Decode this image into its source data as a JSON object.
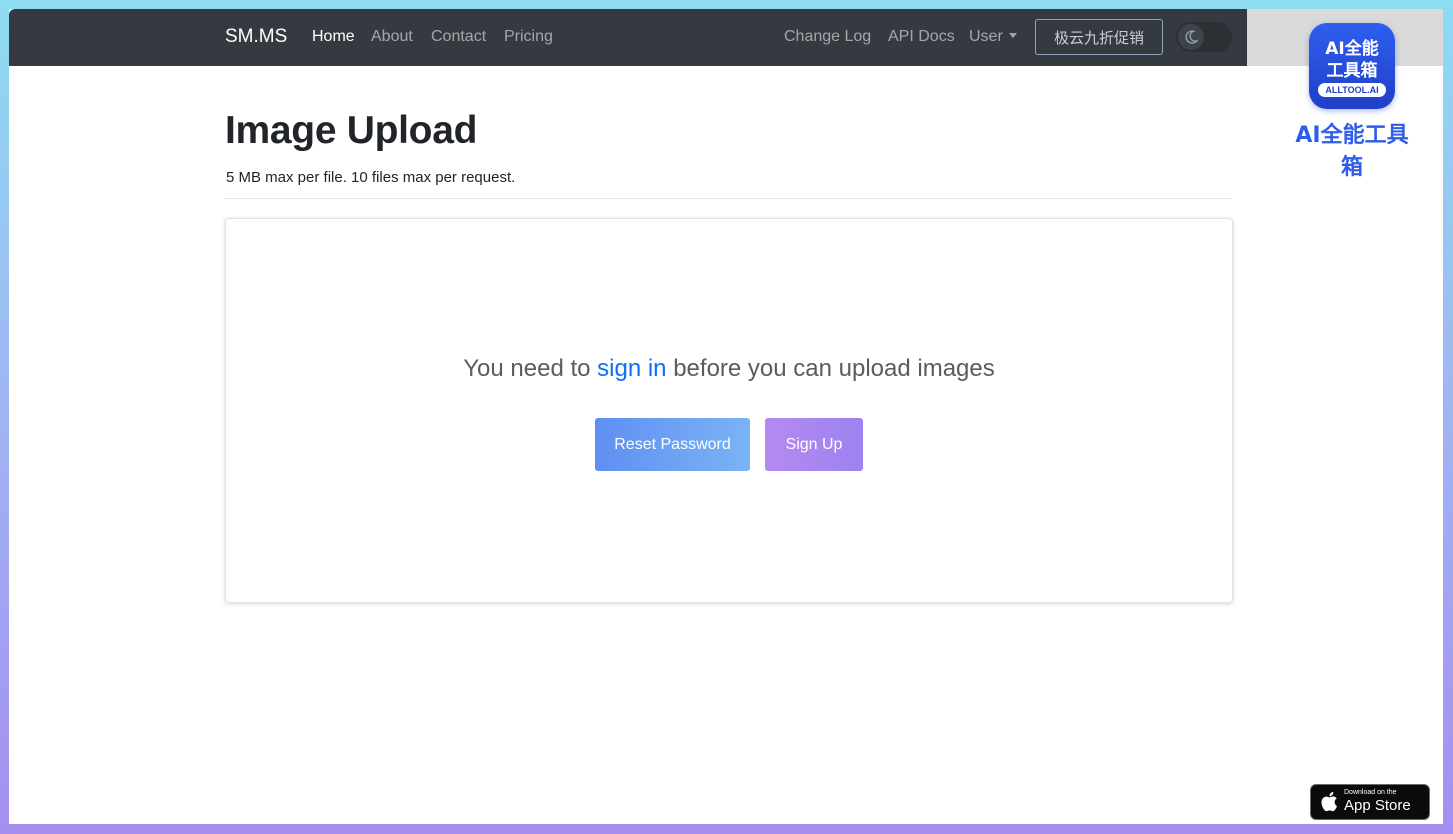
{
  "nav": {
    "brand": "SM.MS",
    "left_links": [
      "Home",
      "About",
      "Contact",
      "Pricing"
    ],
    "right_links": [
      "Change Log",
      "API Docs"
    ],
    "user_menu": "User",
    "promo_button": "极云九折促销",
    "theme_toggle_icon": "moon-icon"
  },
  "main": {
    "title": "Image Upload",
    "subtitle": "5 MB max per file. 10 files max per request.",
    "notice_before": "You need to ",
    "notice_link": "sign in",
    "notice_after": " before you can upload images",
    "reset_password": "Reset Password",
    "sign_up": "Sign Up"
  },
  "overlay": {
    "alltool_line1": "AI全能",
    "alltool_line2": "工具箱",
    "alltool_badge": "ALLTOOL.AI",
    "alltool_caption": "AI全能工具箱",
    "appstore_small": "Download on the",
    "appstore_big": "App Store"
  },
  "colors": {
    "navbar": "#343a40",
    "link": "#0d6efd",
    "reset_gradient": [
      "#5f8ff3",
      "#7ab3f5"
    ],
    "signup_gradient": [
      "#b58af2",
      "#9d82ef"
    ]
  }
}
